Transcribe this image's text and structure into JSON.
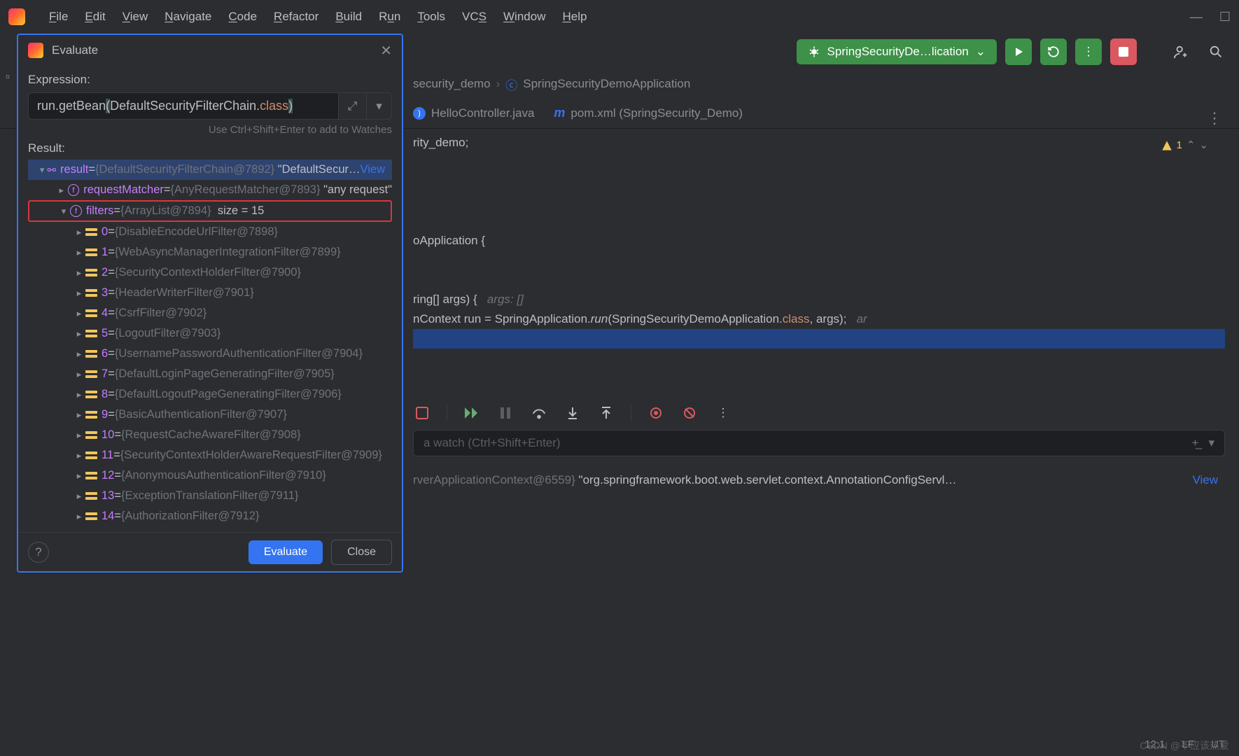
{
  "menu": [
    "File",
    "Edit",
    "View",
    "Navigate",
    "Code",
    "Refactor",
    "Build",
    "Run",
    "Tools",
    "VCS",
    "Window",
    "Help"
  ],
  "topbar": {
    "run_config": "SpringSecurityDe…lication"
  },
  "breadcrumb": {
    "parent": "security_demo",
    "file": "SpringSecurityDemoApplication"
  },
  "tabs": {
    "t1": "HelloController.java",
    "t2": "pom.xml (SpringSecurity_Demo)"
  },
  "editor": {
    "warn_count": "1",
    "lines": {
      "l1": "rity_demo;",
      "l2_a": "oApplication {",
      "l3_a": "ring[] args) {   ",
      "l3_hint": "args: []",
      "l4_a": "nContext ",
      "l4_b": "run",
      "l4_c": " = SpringApplication.",
      "l4_d": "run",
      "l4_e": "(SpringSecurityDemoApplication.",
      "l4_f": "class",
      "l4_g": ", args);",
      "l4_tail": "   ar"
    }
  },
  "dialog": {
    "title": "Evaluate",
    "expr_label": "Expression:",
    "expr_a": "run.getBean",
    "expr_b": "(",
    "expr_c": "DefaultSecurityFilterChain.",
    "expr_d": "class",
    "expr_e": ")",
    "hint": "Use Ctrl+Shift+Enter to add to Watches",
    "result_label": "Result:",
    "root_name": "result",
    "root_type": "{DefaultSecurityFilterChain@7892}",
    "root_val": "\"DefaultSecur…",
    "view": "View",
    "req_name": "requestMatcher",
    "req_type": "{AnyRequestMatcher@7893}",
    "req_val": "\"any request\"",
    "filt_name": "filters",
    "filt_type": "{ArrayList@7894}",
    "filt_size": "size = 15",
    "items": [
      "{DisableEncodeUrlFilter@7898}",
      "{WebAsyncManagerIntegrationFilter@7899}",
      "{SecurityContextHolderFilter@7900}",
      "{HeaderWriterFilter@7901}",
      "{CsrfFilter@7902}",
      "{LogoutFilter@7903}",
      "{UsernamePasswordAuthenticationFilter@7904}",
      "{DefaultLoginPageGeneratingFilter@7905}",
      "{DefaultLogoutPageGeneratingFilter@7906}",
      "{BasicAuthenticationFilter@7907}",
      "{RequestCacheAwareFilter@7908}",
      "{SecurityContextHolderAwareRequestFilter@7909}",
      "{AnonymousAuthenticationFilter@7910}",
      "{ExceptionTranslationFilter@7911}",
      "{AuthorizationFilter@7912}"
    ],
    "evaluate_btn": "Evaluate",
    "close_btn": "Close"
  },
  "watch": {
    "placeholder": "a watch (Ctrl+Shift+Enter)"
  },
  "vars": {
    "type": "rverApplicationContext@6559}",
    "val": "\"org.springframework.boot.web.servlet.context.AnnotationConfigServl…",
    "view": "View"
  },
  "status": {
    "pos": "12:1",
    "eol": "LF",
    "enc": "UT",
    "extra": "CSDN @不应该热爱"
  }
}
